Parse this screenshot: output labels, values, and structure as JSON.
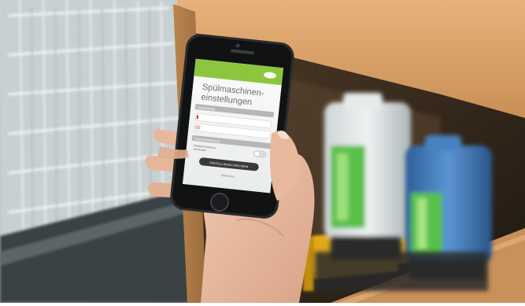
{
  "scene": {
    "description_tags": [
      "dishwasher-rack",
      "wooden-cabinet",
      "detergent-canisters",
      "hand-holding-smartphone"
    ]
  },
  "phone": {
    "app": {
      "brand": "",
      "title_line1": "Spülmaschinen-",
      "title_line2": "einstellungen",
      "section1_header": "Wassertemp",
      "field1_value": "",
      "field2_value": "",
      "section2_header": "Wasserenthärtung",
      "section2_sub1": "Wasserenthärtung",
      "section2_sub2": "verwenden",
      "save_button_label": "EINSTELLUNGEN SPEICHERN",
      "footer_link": "Abbrechen"
    }
  },
  "colors": {
    "app_green": "#8cc63f",
    "app_header_bar": "#7dbb36",
    "section_header_bg": "#b6b6b6",
    "button_bg": "#3a3a3a",
    "canister_green_label": "#59c04a",
    "canister_blue": "#3e7bc0",
    "cabinet_wood": "#d7a06a",
    "tray_orange": "#e0a91c"
  }
}
